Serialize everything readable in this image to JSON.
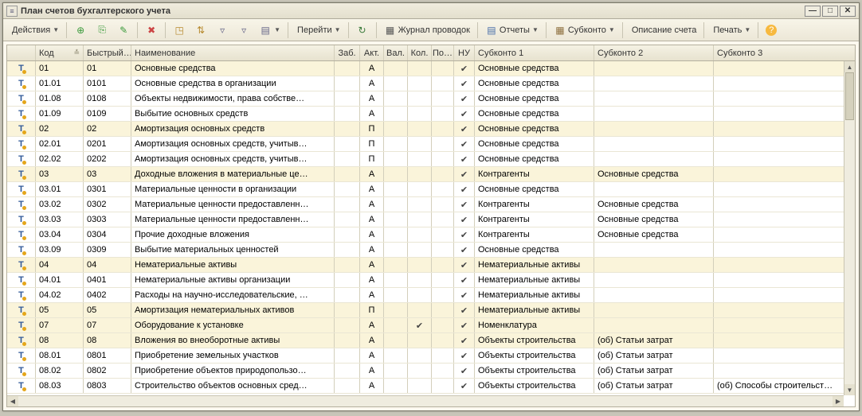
{
  "window": {
    "title": "План счетов бухгалтерского учета"
  },
  "toolbar": {
    "actions": "Действия",
    "goto": "Перейти",
    "journal": "Журнал проводок",
    "reports": "Отчеты",
    "subkonto": "Субконто",
    "account_desc": "Описание счета",
    "print": "Печать"
  },
  "columns": {
    "icon": "",
    "kod": "Код",
    "fast": "Быстрый…",
    "name": "Наименование",
    "zab": "Заб.",
    "akt": "Акт.",
    "val": "Вал.",
    "kol": "Кол.",
    "po": "По…",
    "nu": "НУ",
    "s1": "Субконто 1",
    "s2": "Субконто 2",
    "s3": "Субконто 3"
  },
  "rows": [
    {
      "top": true,
      "kod": "01",
      "fast": "01",
      "name": "Основные средства",
      "akt": "А",
      "kol": false,
      "nu": true,
      "s1": "Основные средства",
      "s2": "",
      "s3": ""
    },
    {
      "top": false,
      "kod": "01.01",
      "fast": "0101",
      "name": "Основные средства в организации",
      "akt": "А",
      "kol": false,
      "nu": true,
      "s1": "Основные средства",
      "s2": "",
      "s3": ""
    },
    {
      "top": false,
      "kod": "01.08",
      "fast": "0108",
      "name": "Объекты недвижимости, права собстве…",
      "akt": "А",
      "kol": false,
      "nu": true,
      "s1": "Основные средства",
      "s2": "",
      "s3": ""
    },
    {
      "top": false,
      "kod": "01.09",
      "fast": "0109",
      "name": "Выбытие основных средств",
      "akt": "А",
      "kol": false,
      "nu": true,
      "s1": "Основные средства",
      "s2": "",
      "s3": ""
    },
    {
      "top": true,
      "kod": "02",
      "fast": "02",
      "name": "Амортизация основных средств",
      "akt": "П",
      "kol": false,
      "nu": true,
      "s1": "Основные средства",
      "s2": "",
      "s3": ""
    },
    {
      "top": false,
      "kod": "02.01",
      "fast": "0201",
      "name": "Амортизация основных средств, учитыв…",
      "akt": "П",
      "kol": false,
      "nu": true,
      "s1": "Основные средства",
      "s2": "",
      "s3": ""
    },
    {
      "top": false,
      "kod": "02.02",
      "fast": "0202",
      "name": "Амортизация основных средств, учитыв…",
      "akt": "П",
      "kol": false,
      "nu": true,
      "s1": "Основные средства",
      "s2": "",
      "s3": ""
    },
    {
      "top": true,
      "kod": "03",
      "fast": "03",
      "name": "Доходные вложения в материальные це…",
      "akt": "А",
      "kol": false,
      "nu": true,
      "s1": "Контрагенты",
      "s2": "Основные средства",
      "s3": ""
    },
    {
      "top": false,
      "kod": "03.01",
      "fast": "0301",
      "name": "Материальные ценности в организации",
      "akt": "А",
      "kol": false,
      "nu": true,
      "s1": "Основные средства",
      "s2": "",
      "s3": ""
    },
    {
      "top": false,
      "kod": "03.02",
      "fast": "0302",
      "name": "Материальные ценности предоставленн…",
      "akt": "А",
      "kol": false,
      "nu": true,
      "s1": "Контрагенты",
      "s2": "Основные средства",
      "s3": ""
    },
    {
      "top": false,
      "kod": "03.03",
      "fast": "0303",
      "name": "Материальные ценности предоставленн…",
      "akt": "А",
      "kol": false,
      "nu": true,
      "s1": "Контрагенты",
      "s2": "Основные средства",
      "s3": ""
    },
    {
      "top": false,
      "kod": "03.04",
      "fast": "0304",
      "name": "Прочие доходные вложения",
      "akt": "А",
      "kol": false,
      "nu": true,
      "s1": "Контрагенты",
      "s2": "Основные средства",
      "s3": ""
    },
    {
      "top": false,
      "kod": "03.09",
      "fast": "0309",
      "name": "Выбытие материальных ценностей",
      "akt": "А",
      "kol": false,
      "nu": true,
      "s1": "Основные средства",
      "s2": "",
      "s3": ""
    },
    {
      "top": true,
      "kod": "04",
      "fast": "04",
      "name": "Нематериальные активы",
      "akt": "А",
      "kol": false,
      "nu": true,
      "s1": "Нематериальные активы",
      "s2": "",
      "s3": ""
    },
    {
      "top": false,
      "kod": "04.01",
      "fast": "0401",
      "name": "Нематериальные активы организации",
      "akt": "А",
      "kol": false,
      "nu": true,
      "s1": "Нематериальные активы",
      "s2": "",
      "s3": ""
    },
    {
      "top": false,
      "kod": "04.02",
      "fast": "0402",
      "name": "Расходы на научно-исследовательские, …",
      "akt": "А",
      "kol": false,
      "nu": true,
      "s1": "Нематериальные активы",
      "s2": "",
      "s3": ""
    },
    {
      "top": true,
      "kod": "05",
      "fast": "05",
      "name": "Амортизация нематериальных активов",
      "akt": "П",
      "kol": false,
      "nu": true,
      "s1": "Нематериальные активы",
      "s2": "",
      "s3": ""
    },
    {
      "top": true,
      "kod": "07",
      "fast": "07",
      "name": "Оборудование к установке",
      "akt": "А",
      "kol": true,
      "nu": true,
      "s1": "Номенклатура",
      "s2": "",
      "s3": ""
    },
    {
      "top": true,
      "kod": "08",
      "fast": "08",
      "name": "Вложения во внеоборотные активы",
      "akt": "А",
      "kol": false,
      "nu": true,
      "s1": "Объекты строительства",
      "s2": "(об) Статьи затрат",
      "s3": ""
    },
    {
      "top": false,
      "kod": "08.01",
      "fast": "0801",
      "name": "Приобретение земельных участков",
      "akt": "А",
      "kol": false,
      "nu": true,
      "s1": "Объекты строительства",
      "s2": "(об) Статьи затрат",
      "s3": ""
    },
    {
      "top": false,
      "kod": "08.02",
      "fast": "0802",
      "name": "Приобретение объектов природопользо…",
      "akt": "А",
      "kol": false,
      "nu": true,
      "s1": "Объекты строительства",
      "s2": "(об) Статьи затрат",
      "s3": ""
    },
    {
      "top": false,
      "kod": "08.03",
      "fast": "0803",
      "name": "Строительство объектов основных сред…",
      "akt": "А",
      "kol": false,
      "nu": true,
      "s1": "Объекты строительства",
      "s2": "(об) Статьи затрат",
      "s3": "(об) Способы строительст…"
    }
  ]
}
